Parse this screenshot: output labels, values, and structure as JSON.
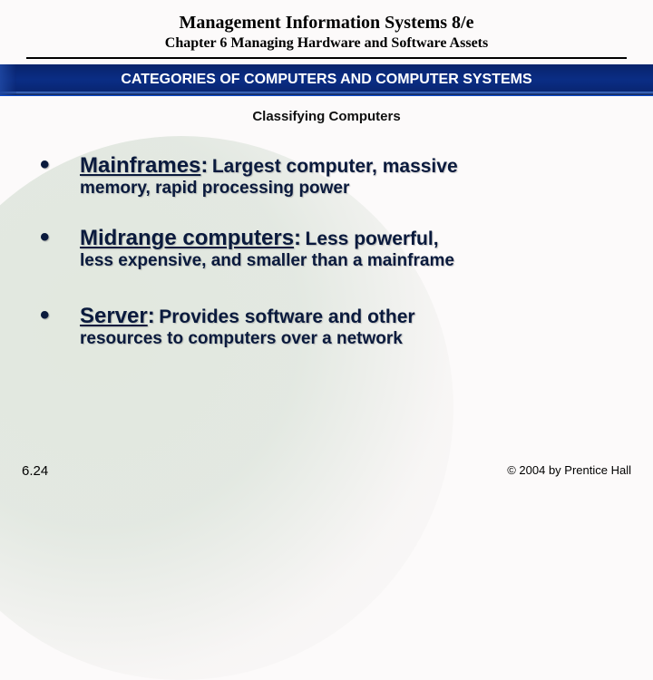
{
  "header": {
    "title": "Management Information Systems 8/e",
    "chapter": "Chapter 6 Managing Hardware and Software Assets",
    "banner": "CATEGORIES OF COMPUTERS AND COMPUTER SYSTEMS",
    "section": "Classifying Computers"
  },
  "bullets": [
    {
      "term": "Mainframes",
      "lead": "Largest computer, massive",
      "rest": "memory, rapid processing power"
    },
    {
      "term": "Midrange computers",
      "lead": "Less powerful,",
      "rest": "less expensive, and smaller than a mainframe"
    },
    {
      "term": "Server",
      "lead": "Provides software and other",
      "rest": "resources to computers over a network"
    }
  ],
  "footer": {
    "slide_number": "6.24",
    "copyright": "© 2004 by Prentice Hall"
  }
}
